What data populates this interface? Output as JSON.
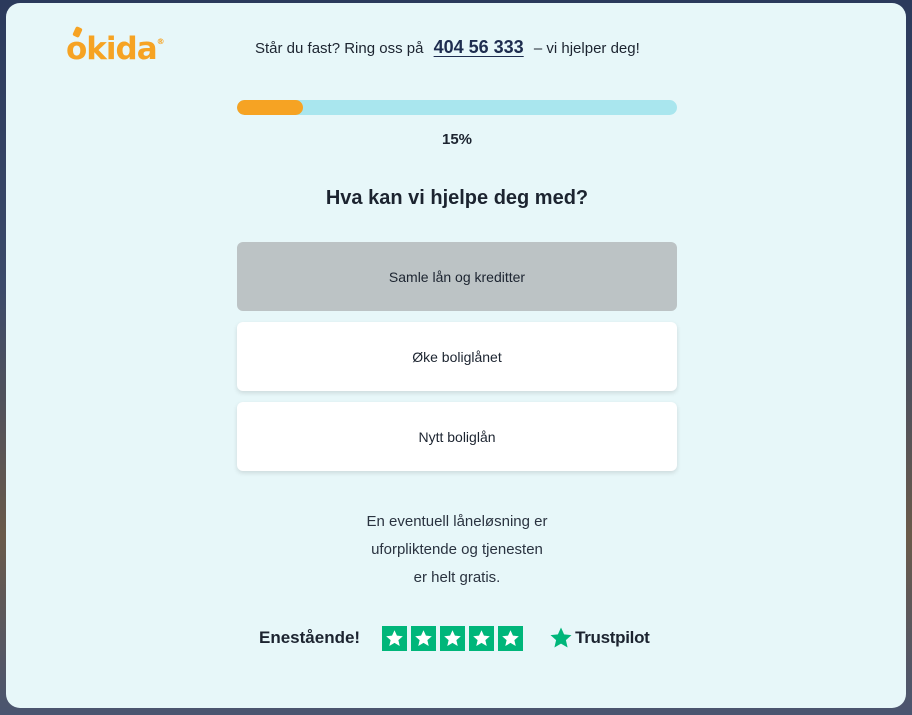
{
  "brand": {
    "name": "okida",
    "color": "#f6a323",
    "trademark": "®"
  },
  "header": {
    "help_prefix": "Står du fast? Ring oss på",
    "phone": "404 56 333",
    "help_suffix": "– vi hjelper deg!"
  },
  "progress": {
    "value_percent": 15,
    "label": "15%",
    "fill_color": "#f6a323",
    "track_color": "#a9e6ee"
  },
  "question": "Hva kan vi hjelpe deg med?",
  "options": [
    {
      "label": "Samle lån og kreditter",
      "selected": true
    },
    {
      "label": "Øke boliglånet",
      "selected": false
    },
    {
      "label": "Nytt boliglån",
      "selected": false
    }
  ],
  "note": {
    "lines": [
      "En eventuell låneløsning er",
      "uforpliktende og tjenesten",
      "er helt gratis."
    ]
  },
  "trustpilot": {
    "rating_text": "Enestående!",
    "stars": 5,
    "star_color": "#00b67a",
    "brand": "Trustpilot"
  }
}
